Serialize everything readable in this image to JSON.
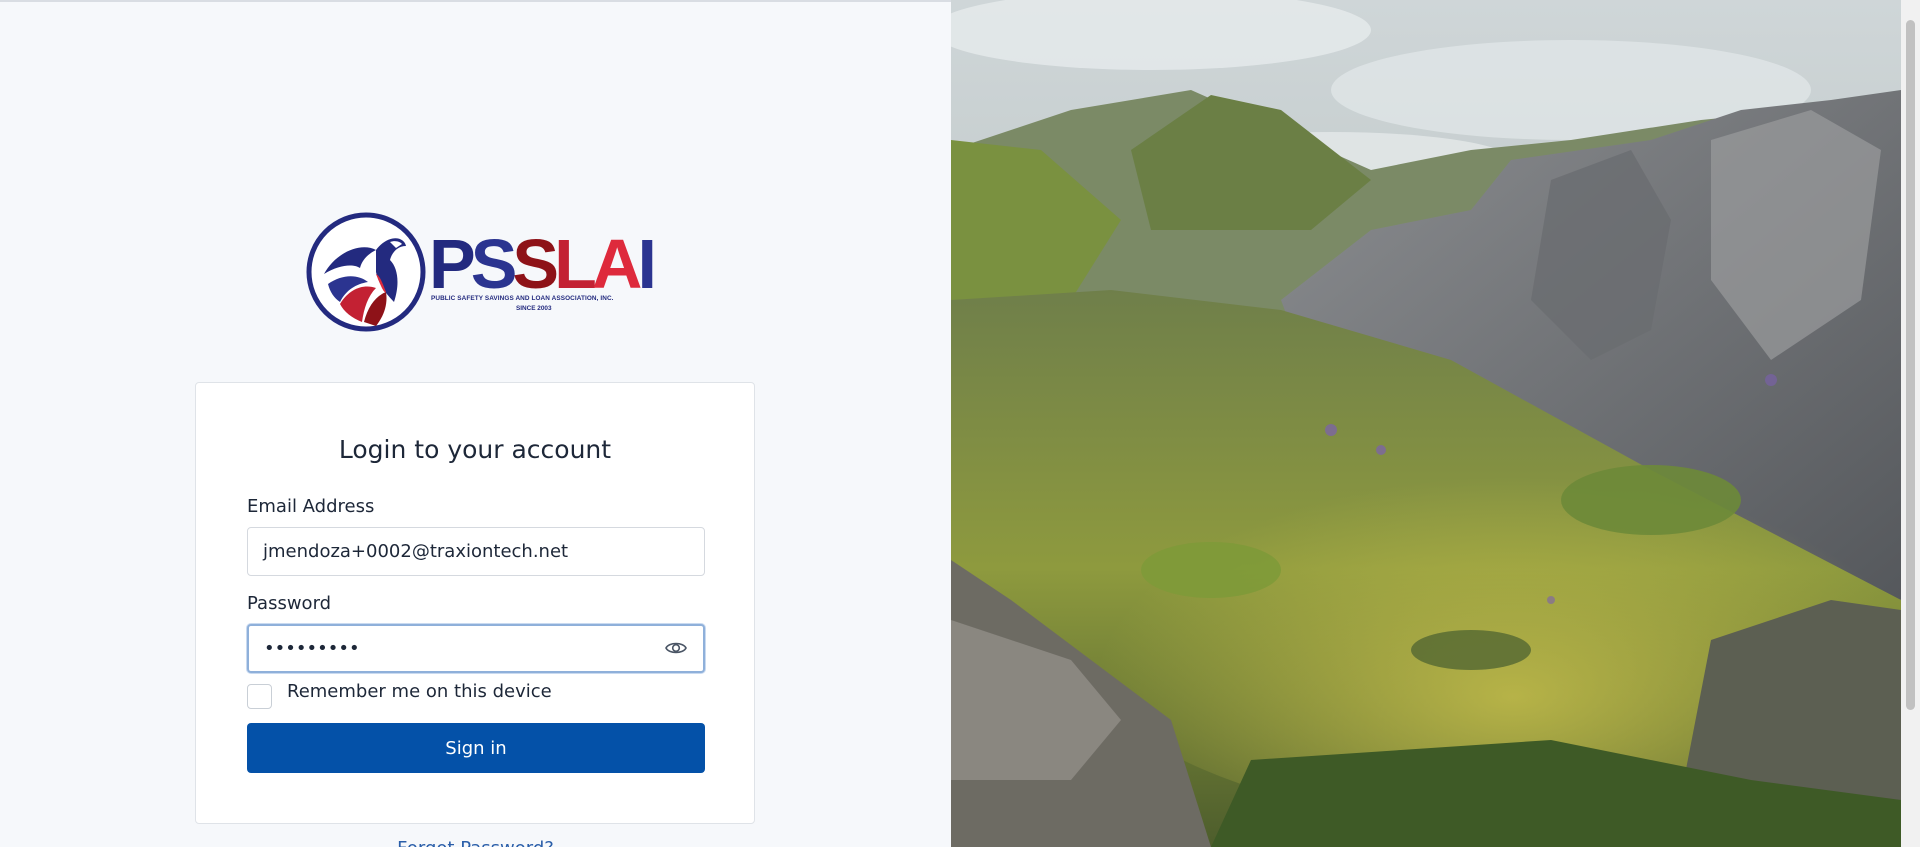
{
  "brand": {
    "word_letters": [
      "P",
      "S",
      "S",
      "L",
      "A",
      "I"
    ],
    "tagline": "PUBLIC SAFETY SAVINGS AND LOAN ASSOCIATION, INC.",
    "since": "SINCE 2003",
    "colors": {
      "navy": "#232a7f",
      "maroon": "#8e1218",
      "red": "#de2a3c"
    }
  },
  "login": {
    "title": "Login to your account",
    "email_label": "Email Address",
    "email_value": "jmendoza+0002@traxiontech.net",
    "password_label": "Password",
    "password_value": "•••••••••",
    "show_password_icon": "eye-icon",
    "remember_label": "Remember me on this device",
    "remember_checked": false,
    "submit_label": "Sign in",
    "forgot_label": "Forgot Password?"
  },
  "colors": {
    "primary": "#0451a8",
    "link": "#2a5ea9",
    "background": "#f6f8fb",
    "focus_ring": "#8fb0da"
  }
}
